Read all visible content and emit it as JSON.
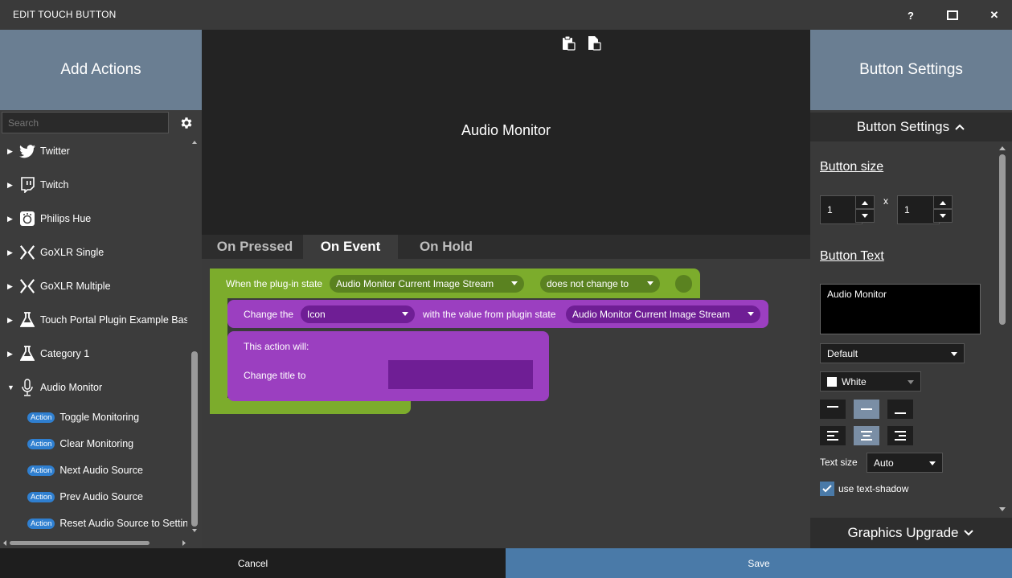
{
  "window": {
    "title": "EDIT TOUCH BUTTON",
    "help": "?",
    "close": "✕"
  },
  "left": {
    "header": "Add Actions",
    "search_placeholder": "Search",
    "categories": [
      {
        "label": "Twitter",
        "icon": "twitter-icon"
      },
      {
        "label": "Twitch",
        "icon": "twitch-icon"
      },
      {
        "label": "Philips Hue",
        "icon": "philips-hue-icon"
      },
      {
        "label": "GoXLR Single",
        "icon": "goxlr-icon"
      },
      {
        "label": "GoXLR Multiple",
        "icon": "goxlr-icon"
      },
      {
        "label": "Touch Portal Plugin Example Base",
        "icon": "flask-icon"
      },
      {
        "label": "Category 1",
        "icon": "flask-icon"
      },
      {
        "label": "Audio Monitor",
        "icon": "microphone-icon"
      }
    ],
    "badge": "Action",
    "actions": [
      "Toggle Monitoring",
      "Clear Monitoring",
      "Next Audio Source",
      "Prev Audio Source",
      "Reset Audio Source to Settings"
    ]
  },
  "center": {
    "preview_title": "Audio Monitor",
    "tabs": [
      "On Pressed",
      "On Event",
      "On Hold"
    ],
    "active_tab": "On Event",
    "event": {
      "prefix": "When the plug-in state",
      "state": "Audio Monitor Current Image Stream",
      "condition": "does not change to"
    },
    "change": {
      "prefix": "Change the",
      "property": "Icon",
      "middle": "with the value from plugin state",
      "state": "Audio Monitor Current Image Stream"
    },
    "action_block": {
      "line1": "This action will:",
      "line2": "Change title to",
      "value": ""
    }
  },
  "right": {
    "header": "Button Settings",
    "section": "Button Settings",
    "button_size_label": "Button size",
    "width": "1",
    "height": "1",
    "x": "x",
    "button_text_label": "Button Text",
    "button_text": "Audio Monitor",
    "font": "Default",
    "color_name": "White",
    "text_size_label": "Text size",
    "text_size": "Auto",
    "shadow_label": "use text-shadow",
    "graphics": "Graphics Upgrade"
  },
  "footer": {
    "cancel": "Cancel",
    "save": "Save"
  },
  "colors": {
    "accent": "#6a7e92",
    "save": "#4a7aa8",
    "event_green": "#7cac2c",
    "purple": "#9b3fc0",
    "badge": "#2f7fd0"
  }
}
